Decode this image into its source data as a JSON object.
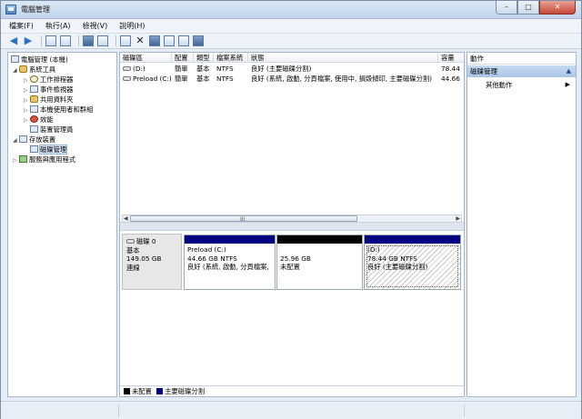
{
  "window": {
    "title": "電腦管理",
    "controls": {
      "minimize": "–",
      "maximize": "□",
      "close": "✕"
    }
  },
  "menu": [
    "檔案(F)",
    "執行(A)",
    "檢視(V)",
    "說明(H)"
  ],
  "tree": {
    "root": "電腦管理 (本機)",
    "system_tools": "系統工具",
    "task_scheduler": "工作排程器",
    "event_viewer": "事件檢視器",
    "shared_folders": "共用資料夾",
    "local_users": "本機使用者和群組",
    "performance": "效能",
    "device_manager": "裝置管理員",
    "storage": "存放裝置",
    "disk_management": "磁碟管理",
    "services": "服務與應用程式"
  },
  "volume_table": {
    "headers": [
      "磁碟區",
      "配置",
      "類型",
      "檔案系統",
      "狀態",
      "容量"
    ],
    "rows": [
      [
        "(D:)",
        "簡單",
        "基本",
        "NTFS",
        "良好 (主要磁碟分割)",
        "78.44"
      ],
      [
        "Preload (C:)",
        "簡單",
        "基本",
        "NTFS",
        "良好 (系統, 啟動, 分頁檔案, 使用中, 損毀傾印, 主要磁碟分割)",
        "44.66"
      ]
    ]
  },
  "scroll_grip": "III",
  "disk": {
    "name": "磁碟 0",
    "type": "基本",
    "size": "149.05 GB",
    "status": "連線"
  },
  "partitions": [
    {
      "name": "Preload  (C:)",
      "size": "44.66 GB NTFS",
      "status": "良好 (系統, 啟動, 分頁檔案,",
      "color": "#000080"
    },
    {
      "name": "",
      "size": "25.96 GB",
      "status": "未配置",
      "color": "#000000"
    },
    {
      "name": "(D:)",
      "size": "78.44 GB NTFS",
      "status": "良好 (主要磁碟分割)",
      "color": "#000080"
    }
  ],
  "legend": [
    {
      "label": "未配置",
      "color": "#000000"
    },
    {
      "label": "主要磁碟分割",
      "color": "#000080"
    }
  ],
  "actions": {
    "header": "動作",
    "section": "磁碟管理",
    "item": "其他動作"
  }
}
